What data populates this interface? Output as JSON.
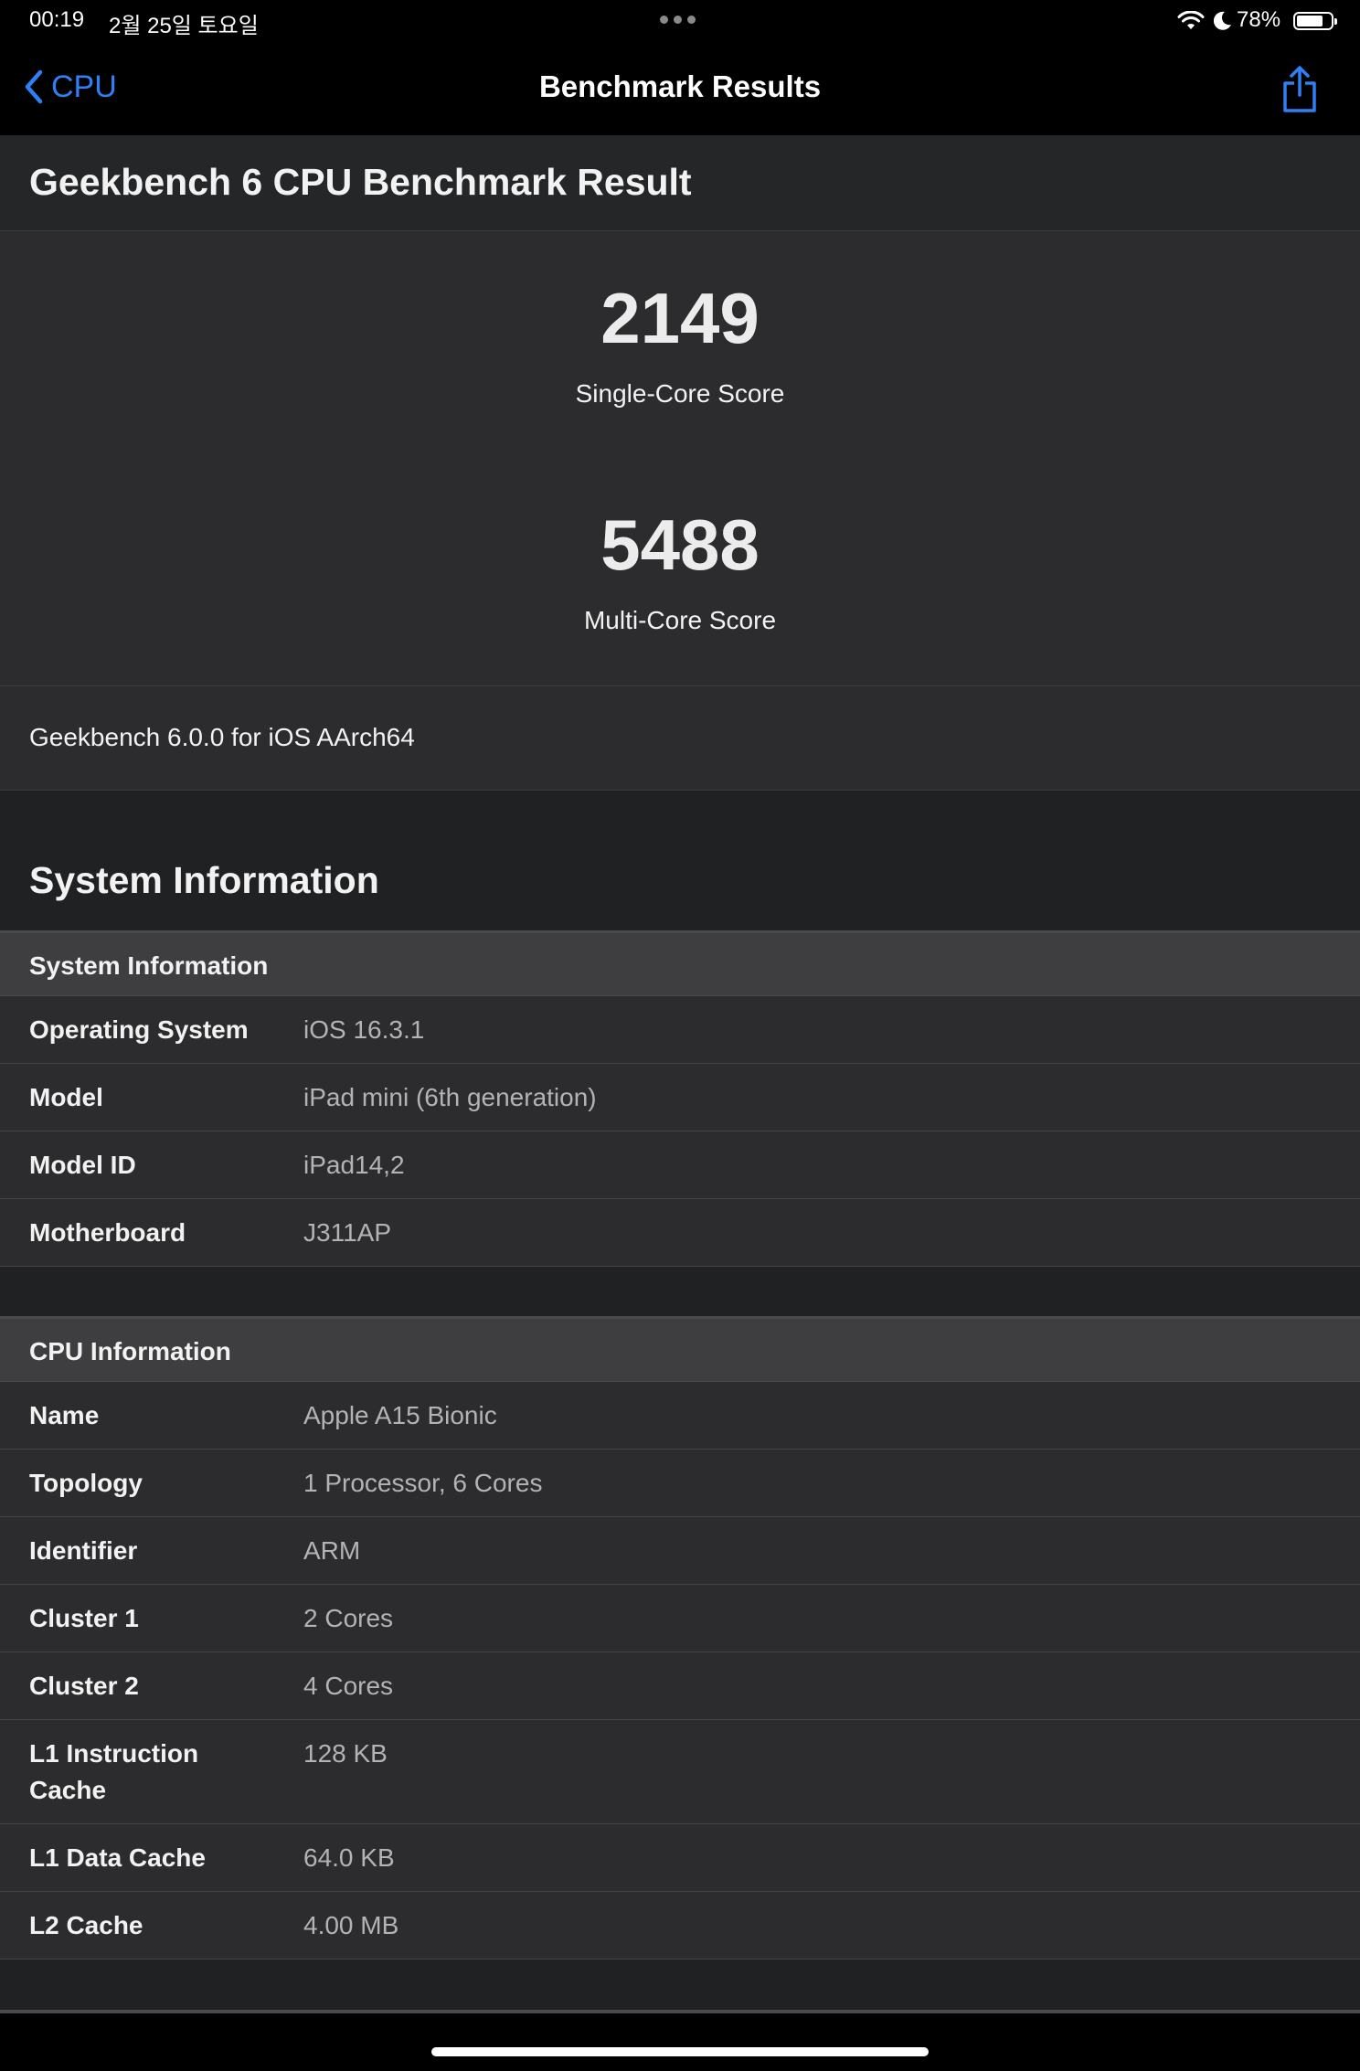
{
  "status": {
    "time": "00:19",
    "date": "2월 25일 토요일",
    "battery_pct": "78%",
    "battery_level": 0.78
  },
  "nav": {
    "back_label": "CPU",
    "title": "Benchmark Results"
  },
  "result": {
    "header": "Geekbench 6 CPU Benchmark Result",
    "single_core_score": "2149",
    "single_core_label": "Single-Core Score",
    "multi_core_score": "5488",
    "multi_core_label": "Multi-Core Score",
    "version": "Geekbench 6.0.0 for iOS AArch64"
  },
  "system_section_title": "System Information",
  "system_info": {
    "heading": "System Information",
    "rows": [
      {
        "key": "Operating System",
        "value": "iOS 16.3.1"
      },
      {
        "key": "Model",
        "value": "iPad mini (6th generation)"
      },
      {
        "key": "Model ID",
        "value": "iPad14,2"
      },
      {
        "key": "Motherboard",
        "value": "J311AP"
      }
    ]
  },
  "cpu_info": {
    "heading": "CPU Information",
    "rows": [
      {
        "key": "Name",
        "value": "Apple A15 Bionic"
      },
      {
        "key": "Topology",
        "value": "1 Processor, 6 Cores"
      },
      {
        "key": "Identifier",
        "value": "ARM"
      },
      {
        "key": "Cluster 1",
        "value": "2 Cores"
      },
      {
        "key": "Cluster 2",
        "value": "4 Cores"
      },
      {
        "key": "L1 Instruction Cache",
        "value": "128 KB"
      },
      {
        "key": "L1 Data Cache",
        "value": "64.0 KB"
      },
      {
        "key": "L2 Cache",
        "value": "4.00 MB"
      }
    ]
  },
  "colors": {
    "accent": "#2f7ff5",
    "background": "#202123",
    "row_bg": "#2c2c2e",
    "table_head_bg": "#3e3e40"
  }
}
